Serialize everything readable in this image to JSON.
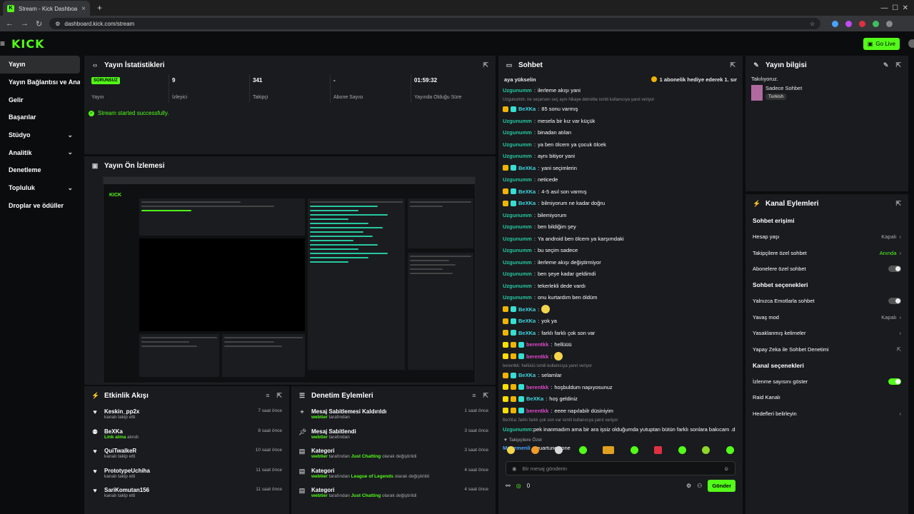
{
  "browser": {
    "tab_title": "Stream - Kick Dashboard",
    "url": "dashboard.kick.com/stream"
  },
  "app": {
    "logo": "KICK",
    "golive_label": "Go Live"
  },
  "sidebar": {
    "items": [
      {
        "label": "Yayın"
      },
      {
        "label": "Yayın Bağlantısı ve Anahtarı"
      },
      {
        "label": "Gelir"
      },
      {
        "label": "Başarılar"
      },
      {
        "label": "Stüdyo"
      },
      {
        "label": "Analitik"
      },
      {
        "label": "Denetleme"
      },
      {
        "label": "Topluluk"
      },
      {
        "label": "Droplar ve ödüller"
      }
    ]
  },
  "stats": {
    "title": "Yayın İstatistikleri",
    "badge": "SORUNSUZ",
    "items": [
      {
        "value": "",
        "label": "Yayın"
      },
      {
        "value": "9",
        "label": "İzleyici"
      },
      {
        "value": "341",
        "label": "Takipçi"
      },
      {
        "value": "-",
        "label": "Abone Sayısı"
      },
      {
        "value": "01:59:32",
        "label": "Yayında Olduğu Süre"
      }
    ],
    "success": "Stream started successfully."
  },
  "preview": {
    "title": "Yayın Ön İzlemesi"
  },
  "activity": {
    "title": "Etkinlik Akışı",
    "items": [
      {
        "name": "Keskin_pp2x",
        "sub": "kanalı takip etti",
        "time": "7 saat önce"
      },
      {
        "name": "BeXKa",
        "sub_hl": "Link atma",
        "sub": " alındı",
        "time": "8 saat önce"
      },
      {
        "name": "QuiTwalkeR",
        "sub": "kanalı takip etti",
        "time": "10 saat önce"
      },
      {
        "name": "PrototypeUchiha",
        "sub": "kanalı takip etti",
        "time": "11 saat önce"
      },
      {
        "name": "SariKomutan156",
        "sub": "kanalı takip etti",
        "time": "11 saat önce"
      }
    ]
  },
  "moderation": {
    "title": "Denetim Eylemleri",
    "items": [
      {
        "name": "Mesaj Sabitlemesi Kaldırıldı",
        "user": "webtier",
        "sub": " tarafından",
        "time": "1 saat önce"
      },
      {
        "name": "Mesaj Sabitlendi",
        "user": "webtier",
        "sub": " tarafından",
        "time": "3 saat önce"
      },
      {
        "name": "Kategori",
        "user": "webtier",
        "mid": " tarafından ",
        "cat": "Just Chatting",
        "sub": " olarak değiştirildi",
        "time": "3 saat önce"
      },
      {
        "name": "Kategori",
        "user": "webtier",
        "mid": " tarafından ",
        "cat": "League of Legends",
        "sub": " olarak değiştirildi",
        "time": "4 saat önce"
      },
      {
        "name": "Kategori",
        "user": "webtier",
        "mid": " tarafından ",
        "cat": "Just Chatting",
        "sub": " olarak değiştirildi",
        "time": "4 saat önce"
      }
    ]
  },
  "chat": {
    "title": "Sohbet",
    "pinned_left": "aya yükselin",
    "pinned_right": "1 abonelik hediye ederek 1. sır",
    "placeholder": "Bir mesaj gönderin",
    "followers_only": "Takipçilere Özel",
    "send": "Gönder",
    "count": "0",
    "messages": [
      {
        "user": "Uzgunumm",
        "text": "ilerleme akışı yani",
        "cls": "u"
      },
      {
        "reply": "Uzgunumm: ne seçersen seç aynı hikaye detroitte ismili kullanıcıya yanıt veriyor"
      },
      {
        "user": "BeXKa",
        "text": "85 sonu varmış",
        "cls": "u2",
        "badges": true
      },
      {
        "user": "Uzgunumm",
        "text": "mesela bir kız var küçük",
        "cls": "u"
      },
      {
        "user": "Uzgunumm",
        "text": "binadan atılan",
        "cls": "u"
      },
      {
        "user": "Uzgunumm",
        "text": "ya ben ölcem ya çocuk ölcek",
        "cls": "u"
      },
      {
        "user": "Uzgunumm",
        "text": "aynı bitiyor yani",
        "cls": "u"
      },
      {
        "user": "BeXKa",
        "text": "yani seçimlerin",
        "cls": "u2",
        "badges": true
      },
      {
        "user": "Uzgunumm",
        "text": "neticede",
        "cls": "u"
      },
      {
        "user": "BeXKa",
        "text": "4-5 asıl son varmış",
        "cls": "u2",
        "badges": true
      },
      {
        "user": "BeXKa",
        "text": "bilmiyorum ne kadar doğru",
        "cls": "u2",
        "badges": true
      },
      {
        "user": "Uzgunumm",
        "text": "bilemiyorum",
        "cls": "u"
      },
      {
        "user": "Uzgunumm",
        "text": "ben bildiğim şey",
        "cls": "u"
      },
      {
        "user": "Uzgunumm",
        "text": "Ya android ben ölcem ya karşımdaki",
        "cls": "u"
      },
      {
        "user": "Uzgunumm",
        "text": "bu seçim sadece",
        "cls": "u"
      },
      {
        "user": "Uzgunumm",
        "text": "ilerleme akışı değiştirmiyor",
        "cls": "u"
      },
      {
        "user": "Uzgunumm",
        "text": "ben şeye kadar geldimdi",
        "cls": "u"
      },
      {
        "user": "Uzgunumm",
        "text": "tekerlekli dede vardı",
        "cls": "u"
      },
      {
        "user": "Uzgunumm",
        "text": "onu kurtardım ben öldüm",
        "cls": "u"
      },
      {
        "user": "BeXKa",
        "text": "",
        "cls": "u2",
        "badges": true,
        "emoji": true
      },
      {
        "user": "BeXKa",
        "text": "yok ya",
        "cls": "u2",
        "badges": true
      },
      {
        "user": "BeXKa",
        "text": "farklı farklı çok son var",
        "cls": "u2",
        "badges": true
      },
      {
        "user": "berentkk",
        "text": "hellüüü",
        "cls": "u3",
        "badges3": true
      },
      {
        "user": "berentkk",
        "text": "",
        "cls": "u3",
        "badges3": true,
        "emoji": true
      },
      {
        "reply": "berentkk: hellüüü ismili kullanıcıya yanıt veriyor"
      },
      {
        "user": "BeXKa",
        "text": "selamlar",
        "cls": "u2",
        "badges": true
      },
      {
        "user": "berentkk",
        "text": "hoşbuldum napıyosunuz",
        "cls": "u3",
        "badges3": true
      },
      {
        "user": "BeXKa",
        "text": "hoş geldiniz",
        "cls": "u2",
        "badges3": true
      },
      {
        "user": "berentkk",
        "text": "eeee napılabilr düsiniyim",
        "cls": "u3",
        "badges3": true
      },
      {
        "reply": "BeXKa: farklı farklı çok son var ismili kullanıcıya yanıt veriyor"
      },
      {
        "user": "Uzgunumm",
        "text": "pek inanmadım ama bir ara işsiz olduğumda yutuptan bütün farklı sonlara bakıcam .d",
        "cls": "u",
        "tall": true
      },
      {
        "user": "Menemenli",
        "text": "quartune zone",
        "cls": "u4"
      }
    ]
  },
  "streaminfo": {
    "title": "Yayın bilgisi",
    "status": "Takılıyoruz.",
    "category": "Sadece Sohbet",
    "tag": "Turkish"
  },
  "channel": {
    "title": "Kanal Eylemleri",
    "sec1": "Sohbet erişimi",
    "rows1": [
      {
        "label": "Hesap yaşı",
        "value": "Kapalı",
        "type": "chev"
      },
      {
        "label": "Takipçilere özel sohbet",
        "value": "Anında",
        "type": "chev",
        "on": true
      },
      {
        "label": "Abonelere özel sohbet",
        "type": "toggle"
      }
    ],
    "sec2": "Sohbet seçenekleri",
    "rows2": [
      {
        "label": "Yalnızca Emotlarla sohbet",
        "type": "toggle"
      },
      {
        "label": "Yavaş mod",
        "value": "Kapalı",
        "type": "chev"
      },
      {
        "label": "Yasaklanmış kelimeler",
        "type": "chev"
      },
      {
        "label": "Yapay Zeka ile Sohbet Denetimi",
        "type": "ext"
      }
    ],
    "sec3": "Kanal seçenekleri",
    "rows3": [
      {
        "label": "İzlenme sayısını göster",
        "type": "toggle-on"
      },
      {
        "label": "Raid Kanalı",
        "type": "none"
      },
      {
        "label": "Hedefleri belirleyin",
        "type": "chev"
      }
    ]
  }
}
